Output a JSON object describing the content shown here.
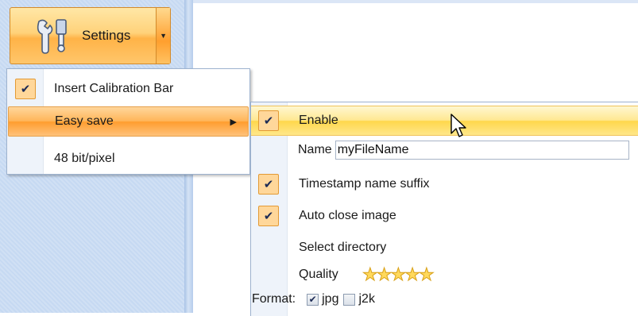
{
  "ribbon": {
    "settings_label": "Settings",
    "icons": {
      "settings": "tools-icon",
      "split": "chevron-down-icon"
    }
  },
  "menu": {
    "items": [
      {
        "label": "Insert Calibration Bar",
        "checked": true
      },
      {
        "label": "Easy save",
        "has_submenu": true,
        "highlighted": true
      },
      {
        "label": "48 bit/pixel",
        "checked": false
      }
    ]
  },
  "easy_save": {
    "enable_label": "Enable",
    "name_label": "Name",
    "name_value": "myFileName",
    "timestamp_label": "Timestamp name suffix",
    "auto_close_label": "Auto close image",
    "select_directory_label": "Select directory",
    "quality_label": "Quality",
    "quality_stars": 5,
    "format_label": "Format:",
    "formats": [
      {
        "label": "jpg",
        "checked": true
      },
      {
        "label": "j2k",
        "checked": false
      }
    ]
  },
  "colors": {
    "highlight_orange": "#ffb347",
    "highlight_yellow": "#ffe892",
    "ribbon_blue": "#c6d9f2"
  }
}
